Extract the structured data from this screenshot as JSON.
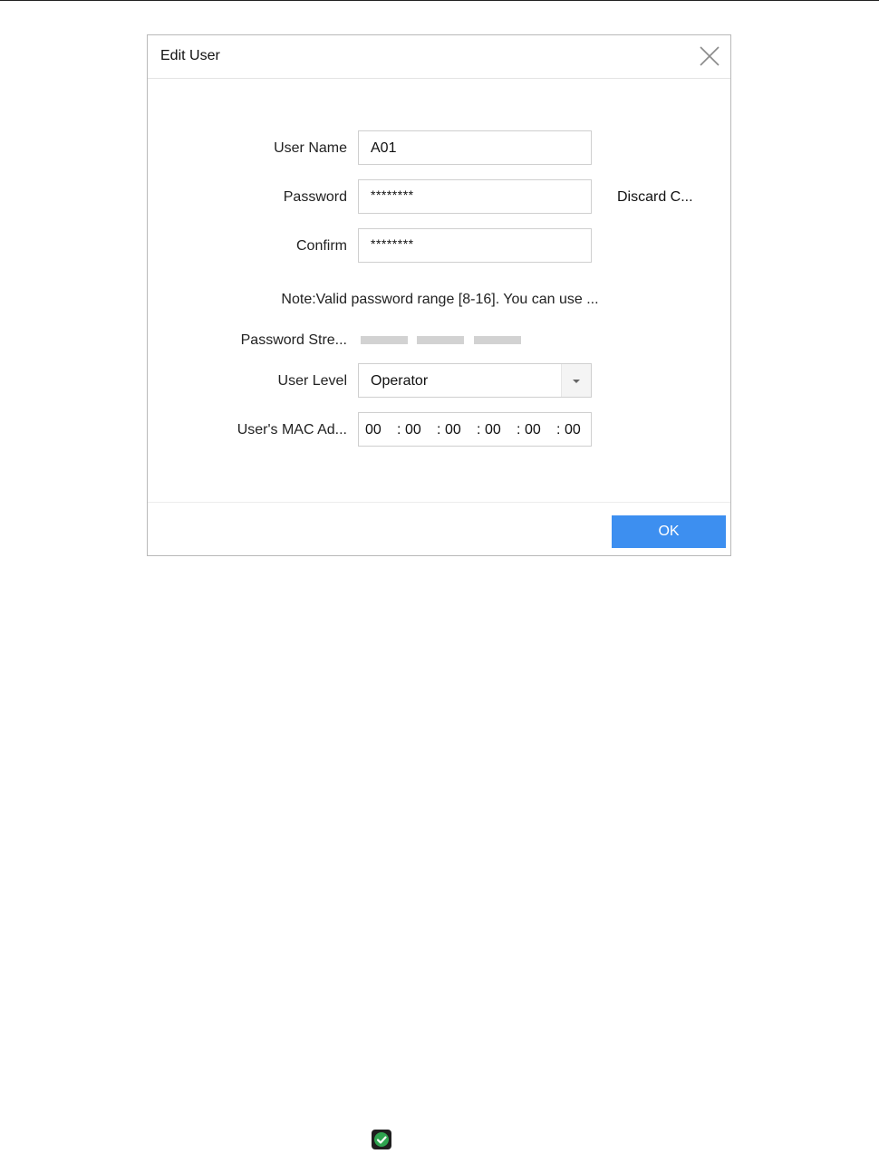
{
  "dialog": {
    "title": "Edit User",
    "fields": {
      "user_name": {
        "label": "User Name",
        "value": "A01"
      },
      "password": {
        "label": "Password",
        "value": "********",
        "discard_label": "Discard C..."
      },
      "confirm": {
        "label": "Confirm",
        "value": "********"
      },
      "note": "Note:Valid password range [8-16]. You can use ...",
      "strength": {
        "label": "Password Stre..."
      },
      "user_level": {
        "label": "User Level",
        "value": "Operator"
      },
      "mac": {
        "label": "User's MAC Ad...",
        "segments": [
          "00",
          "00",
          "00",
          "00",
          "00",
          "00"
        ]
      }
    },
    "ok_label": "OK"
  },
  "icons": {
    "close": "close-icon",
    "dropdown": "chevron-down-icon",
    "check": "check-circle-icon"
  },
  "colors": {
    "accent": "#3d8ff0",
    "strength_bar": "#d2d2d2",
    "check": "#2ea44f"
  }
}
